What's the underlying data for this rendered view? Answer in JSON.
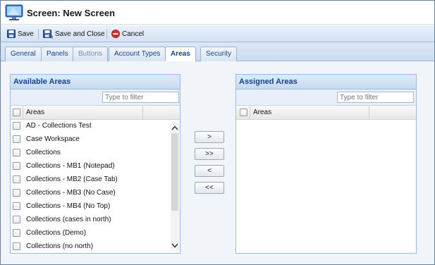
{
  "window": {
    "title": "Screen: New Screen",
    "icon": "monitor-icon"
  },
  "toolbar": {
    "save_label": "Save",
    "save_close_label": "Save and Close",
    "cancel_label": "Cancel"
  },
  "tabs": [
    {
      "label": "General",
      "state": "normal"
    },
    {
      "label": "Panels",
      "state": "normal"
    },
    {
      "label": "Buttons",
      "state": "disabled"
    },
    {
      "label": "Account Types",
      "state": "normal"
    },
    {
      "label": "Areas",
      "state": "active"
    },
    {
      "label": "Security",
      "state": "normal"
    }
  ],
  "available": {
    "title": "Available Areas",
    "filter_placeholder": "Type to filter",
    "column": "Areas",
    "rows": [
      "AD - Collections Test",
      "Case Workspace",
      "Collections",
      "Collections - MB1 (Notepad)",
      "Collections - MB2 (Case Tab)",
      "Collections - MB3 (No Case)",
      "Collections - MB4 (No Top)",
      "Collections (cases in north)",
      "Collections (Demo)",
      "Collections (no north)"
    ]
  },
  "assigned": {
    "title": "Assigned Areas",
    "filter_placeholder": "Type to filter",
    "column": "Areas",
    "rows": []
  },
  "move_buttons": {
    "add": ">",
    "add_all": ">>",
    "remove": "<",
    "remove_all": "<<"
  },
  "colors": {
    "panel_header_text": "#15428b",
    "toolbar_bg": "#d4e2f3",
    "cancel_icon": "#d9342b"
  }
}
